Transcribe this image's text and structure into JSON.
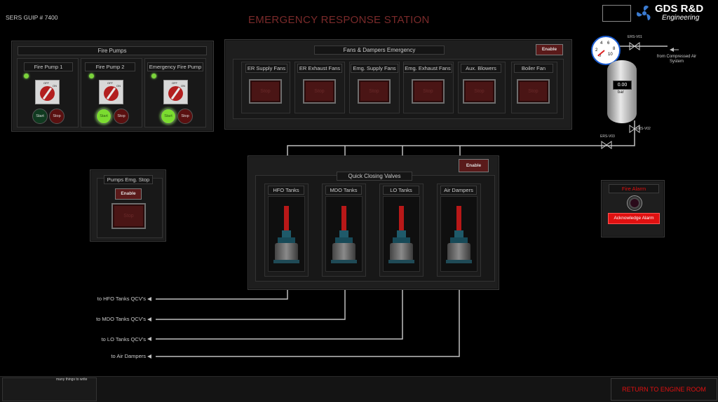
{
  "header": {
    "station_id": "SERS GUIP # 7400",
    "title": "EMERGENCY RESPONSE STATION",
    "logo_text": "GDS R&D",
    "logo_sub": "Engineering"
  },
  "fire_pumps": {
    "title": "Fire Pumps",
    "pumps": [
      {
        "label": "Fire Pump 1",
        "start": "Start",
        "stop": "Stop"
      },
      {
        "label": "Fire Pump 2",
        "start": "Start",
        "stop": "Stop"
      },
      {
        "label": "Emergency Fire Pump",
        "start": "Start",
        "stop": "Stop"
      }
    ],
    "selector_off": "OFF",
    "selector_on": "ON"
  },
  "fans": {
    "title": "Fans & Dampers Emergency",
    "enable": "Enable",
    "stop": "Stop",
    "items": [
      "ER Supply Fans",
      "ER Exhaust Fans",
      "Emg. Supply Fans",
      "Emg. Exhaust Fans",
      "Aux. Blowers",
      "Boiler Fan"
    ]
  },
  "pumps_emg": {
    "title": "Pumps Emg. Stop",
    "enable": "Enable",
    "stop": "Stop"
  },
  "qcv": {
    "enable": "Enable",
    "title": "Quick Closing Valves",
    "items": [
      "HFO Tanks",
      "MDO Tanks",
      "LO Tanks",
      "Air Dampers"
    ]
  },
  "destinations": [
    "to HFO Tanks QCV's",
    "to MDO Tanks QCV's",
    "to LO Tanks QCV's",
    "to Air Dampers"
  ],
  "vessel": {
    "gauge_ticks": [
      "2",
      "4",
      "6",
      "8",
      "0",
      "10"
    ],
    "value": "0.00",
    "unit": "bar",
    "v1": "ERS-V01",
    "v2": "ERS-V02",
    "v3": "ERS-V03",
    "source": "from Compressed Air System"
  },
  "fire_alarm": {
    "title": "Fire Alarm",
    "ack": "Acknowledge Alarm"
  },
  "footer": {
    "notes": "many things to write",
    "return": "RETURN TO ENGINE ROOM"
  },
  "colors": {
    "title": "#7a2a2a",
    "alarm_red": "#e01010",
    "led_green": "#7bd33a"
  }
}
